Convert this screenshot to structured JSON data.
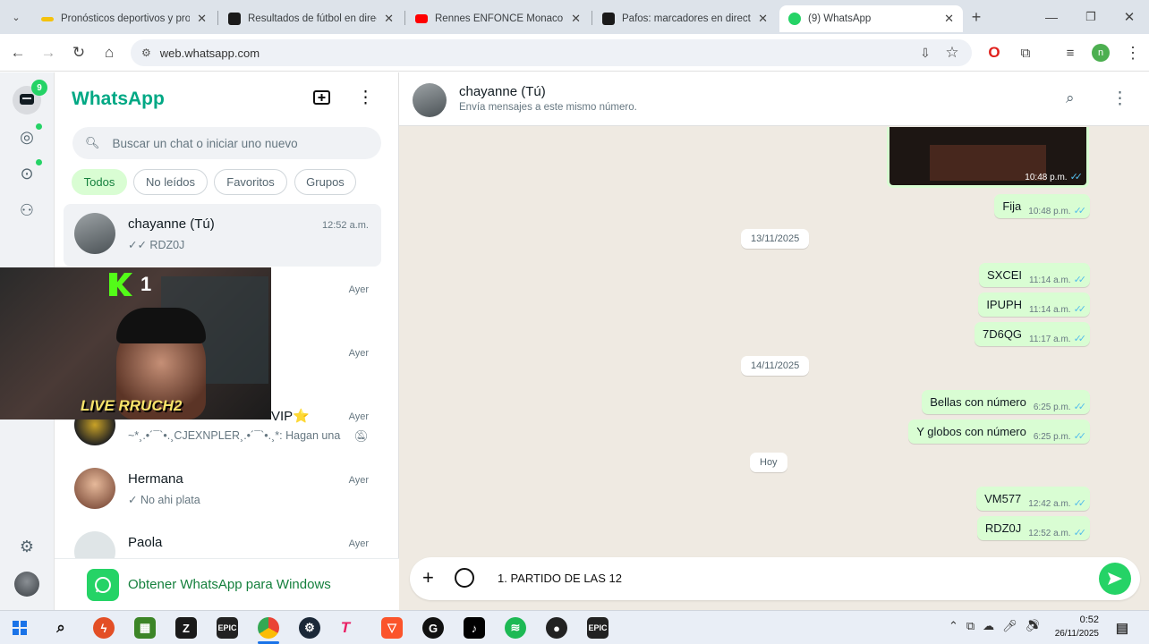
{
  "browser": {
    "tabs": [
      {
        "title": "Pronósticos deportivos y pro",
        "color": "#f4c20d"
      },
      {
        "title": "Resultados de fútbol en direc",
        "color": "#1a1a1a"
      },
      {
        "title": "Rennes ENFONCE Monaco r",
        "color": "#ff0000"
      },
      {
        "title": "Pafos: marcadores en directo",
        "color": "#1a1a1a"
      },
      {
        "title": "(9) WhatsApp",
        "color": "#25d366"
      }
    ],
    "url": "web.whatsapp.com",
    "profile_initial": "n"
  },
  "whatsapp": {
    "brand": "WhatsApp",
    "brand_color": "#00a884",
    "unread_badge": "9",
    "search_placeholder": "Buscar un chat o iniciar uno nuevo",
    "filters": [
      "Todos",
      "No leídos",
      "Favoritos",
      "Grupos"
    ],
    "chats": [
      {
        "name": "chayanne (Tú)",
        "msg": "✓✓ RDZ0J",
        "time": "12:52 a.m."
      },
      {
        "name": "",
        "msg": "",
        "time": "Ayer"
      },
      {
        "name": "",
        "msg": "",
        "time": "Ayer"
      },
      {
        "name": "VIP⭐",
        "msg": "~*¸.•´¯`•.¸CJEXNPLER¸.•´¯`•.¸*: Hagan una ...",
        "time": "Ayer"
      },
      {
        "name": "Hermana",
        "msg": "✓ No ahi plata",
        "time": "Ayer"
      },
      {
        "name": "Paola",
        "msg": "",
        "time": "Ayer"
      }
    ],
    "get_app": "Obtener WhatsApp para Windows",
    "stream_overlay": {
      "counter": "1",
      "caption": "LIVE RRUCH2"
    },
    "chat_header": {
      "name": "chayanne (Tú)",
      "subtitle": "Envía mensajes a este mismo número."
    },
    "messages": [
      {
        "text": "Fija",
        "time": "10:48 p.m."
      },
      {
        "text": "SXCEI",
        "time": "11:14 a.m."
      },
      {
        "text": "IPUPH",
        "time": "11:14 a.m."
      },
      {
        "text": "7D6QG",
        "time": "11:17 a.m."
      },
      {
        "text": "Bellas con número",
        "time": "6:25 p.m."
      },
      {
        "text": "Y globos con número",
        "time": "6:25 p.m."
      },
      {
        "text": "VM577",
        "time": "12:42 a.m."
      },
      {
        "text": "RDZ0J",
        "time": "12:52 a.m."
      }
    ],
    "image_time": "10:48 p.m.",
    "dates": [
      "13/11/2025",
      "14/11/2025",
      "Hoy"
    ],
    "composer_value": "1. PARTIDO DE LAS 12"
  },
  "taskbar": {
    "time": "0:52",
    "date": "26/11/2025"
  }
}
